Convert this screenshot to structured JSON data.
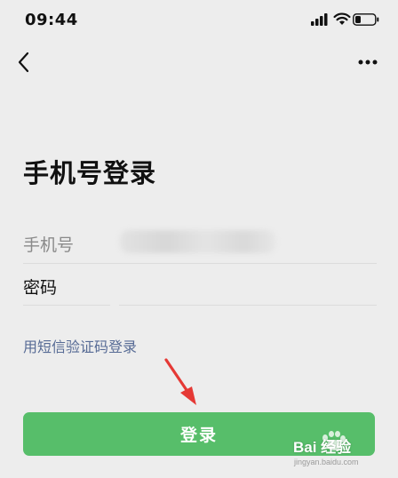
{
  "status_bar": {
    "time": "09:44"
  },
  "nav": {
    "back_icon": "chevron-left-icon",
    "more_icon": "more-dots-icon"
  },
  "page": {
    "title": "手机号登录"
  },
  "form": {
    "phone_label": "手机号",
    "phone_value": "",
    "password_label": "密码",
    "password_value": ""
  },
  "links": {
    "sms_login": "用短信验证码登录"
  },
  "buttons": {
    "login": "登录"
  },
  "watermark": {
    "brand": "Bai 经验",
    "url": "jingyan.baidu.com"
  },
  "colors": {
    "background": "#ededed",
    "accent_green": "#57be6a",
    "link_blue": "#576b95",
    "arrow_red": "#e53935"
  }
}
